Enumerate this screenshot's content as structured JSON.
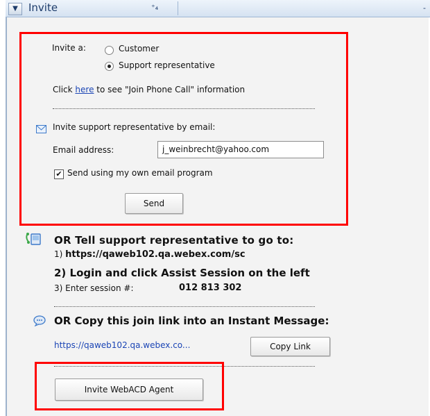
{
  "titlebar": {
    "title": "Invite",
    "toggle_glyph": "▼",
    "pin_glyph": "⁺₄",
    "right_glyph": "-"
  },
  "invite_form": {
    "invite_as_label": "Invite a:",
    "options": [
      {
        "label": "Customer",
        "selected": false
      },
      {
        "label": "Support representative",
        "selected": true
      }
    ],
    "click_prefix": "Click",
    "click_link": "here",
    "click_suffix": "to see \"Join Phone Call\" information",
    "email_heading": "Invite support representative by email:",
    "email_label": "Email address:",
    "email_value": "j_weinbrecht@yahoo.com",
    "send_own_label": "Send using my own email program",
    "send_own_checked": true,
    "send_button": "Send"
  },
  "tell_section": {
    "heading": "OR Tell support representative to go to:",
    "step1_prefix": "1)",
    "step1_url": "https://qaweb102.qa.webex.com/sc",
    "step2": "2) Login and click Assist Session on the left",
    "step3_label": "3) Enter session #:",
    "session_number": "012 813 302"
  },
  "copy_section": {
    "heading": "OR Copy this join link into an Instant Message:",
    "link_text": "https://qaweb102.qa.webex.co...",
    "copy_button": "Copy Link"
  },
  "webacd_button": "Invite WebACD Agent",
  "colors": {
    "highlight": "#ff0000",
    "link": "#1b45b5",
    "titlebar_text": "#1d3c6b"
  },
  "icons": {
    "email": "envelope-icon",
    "tell": "phone-computer-icon",
    "copy": "chat-bubble-icon"
  }
}
